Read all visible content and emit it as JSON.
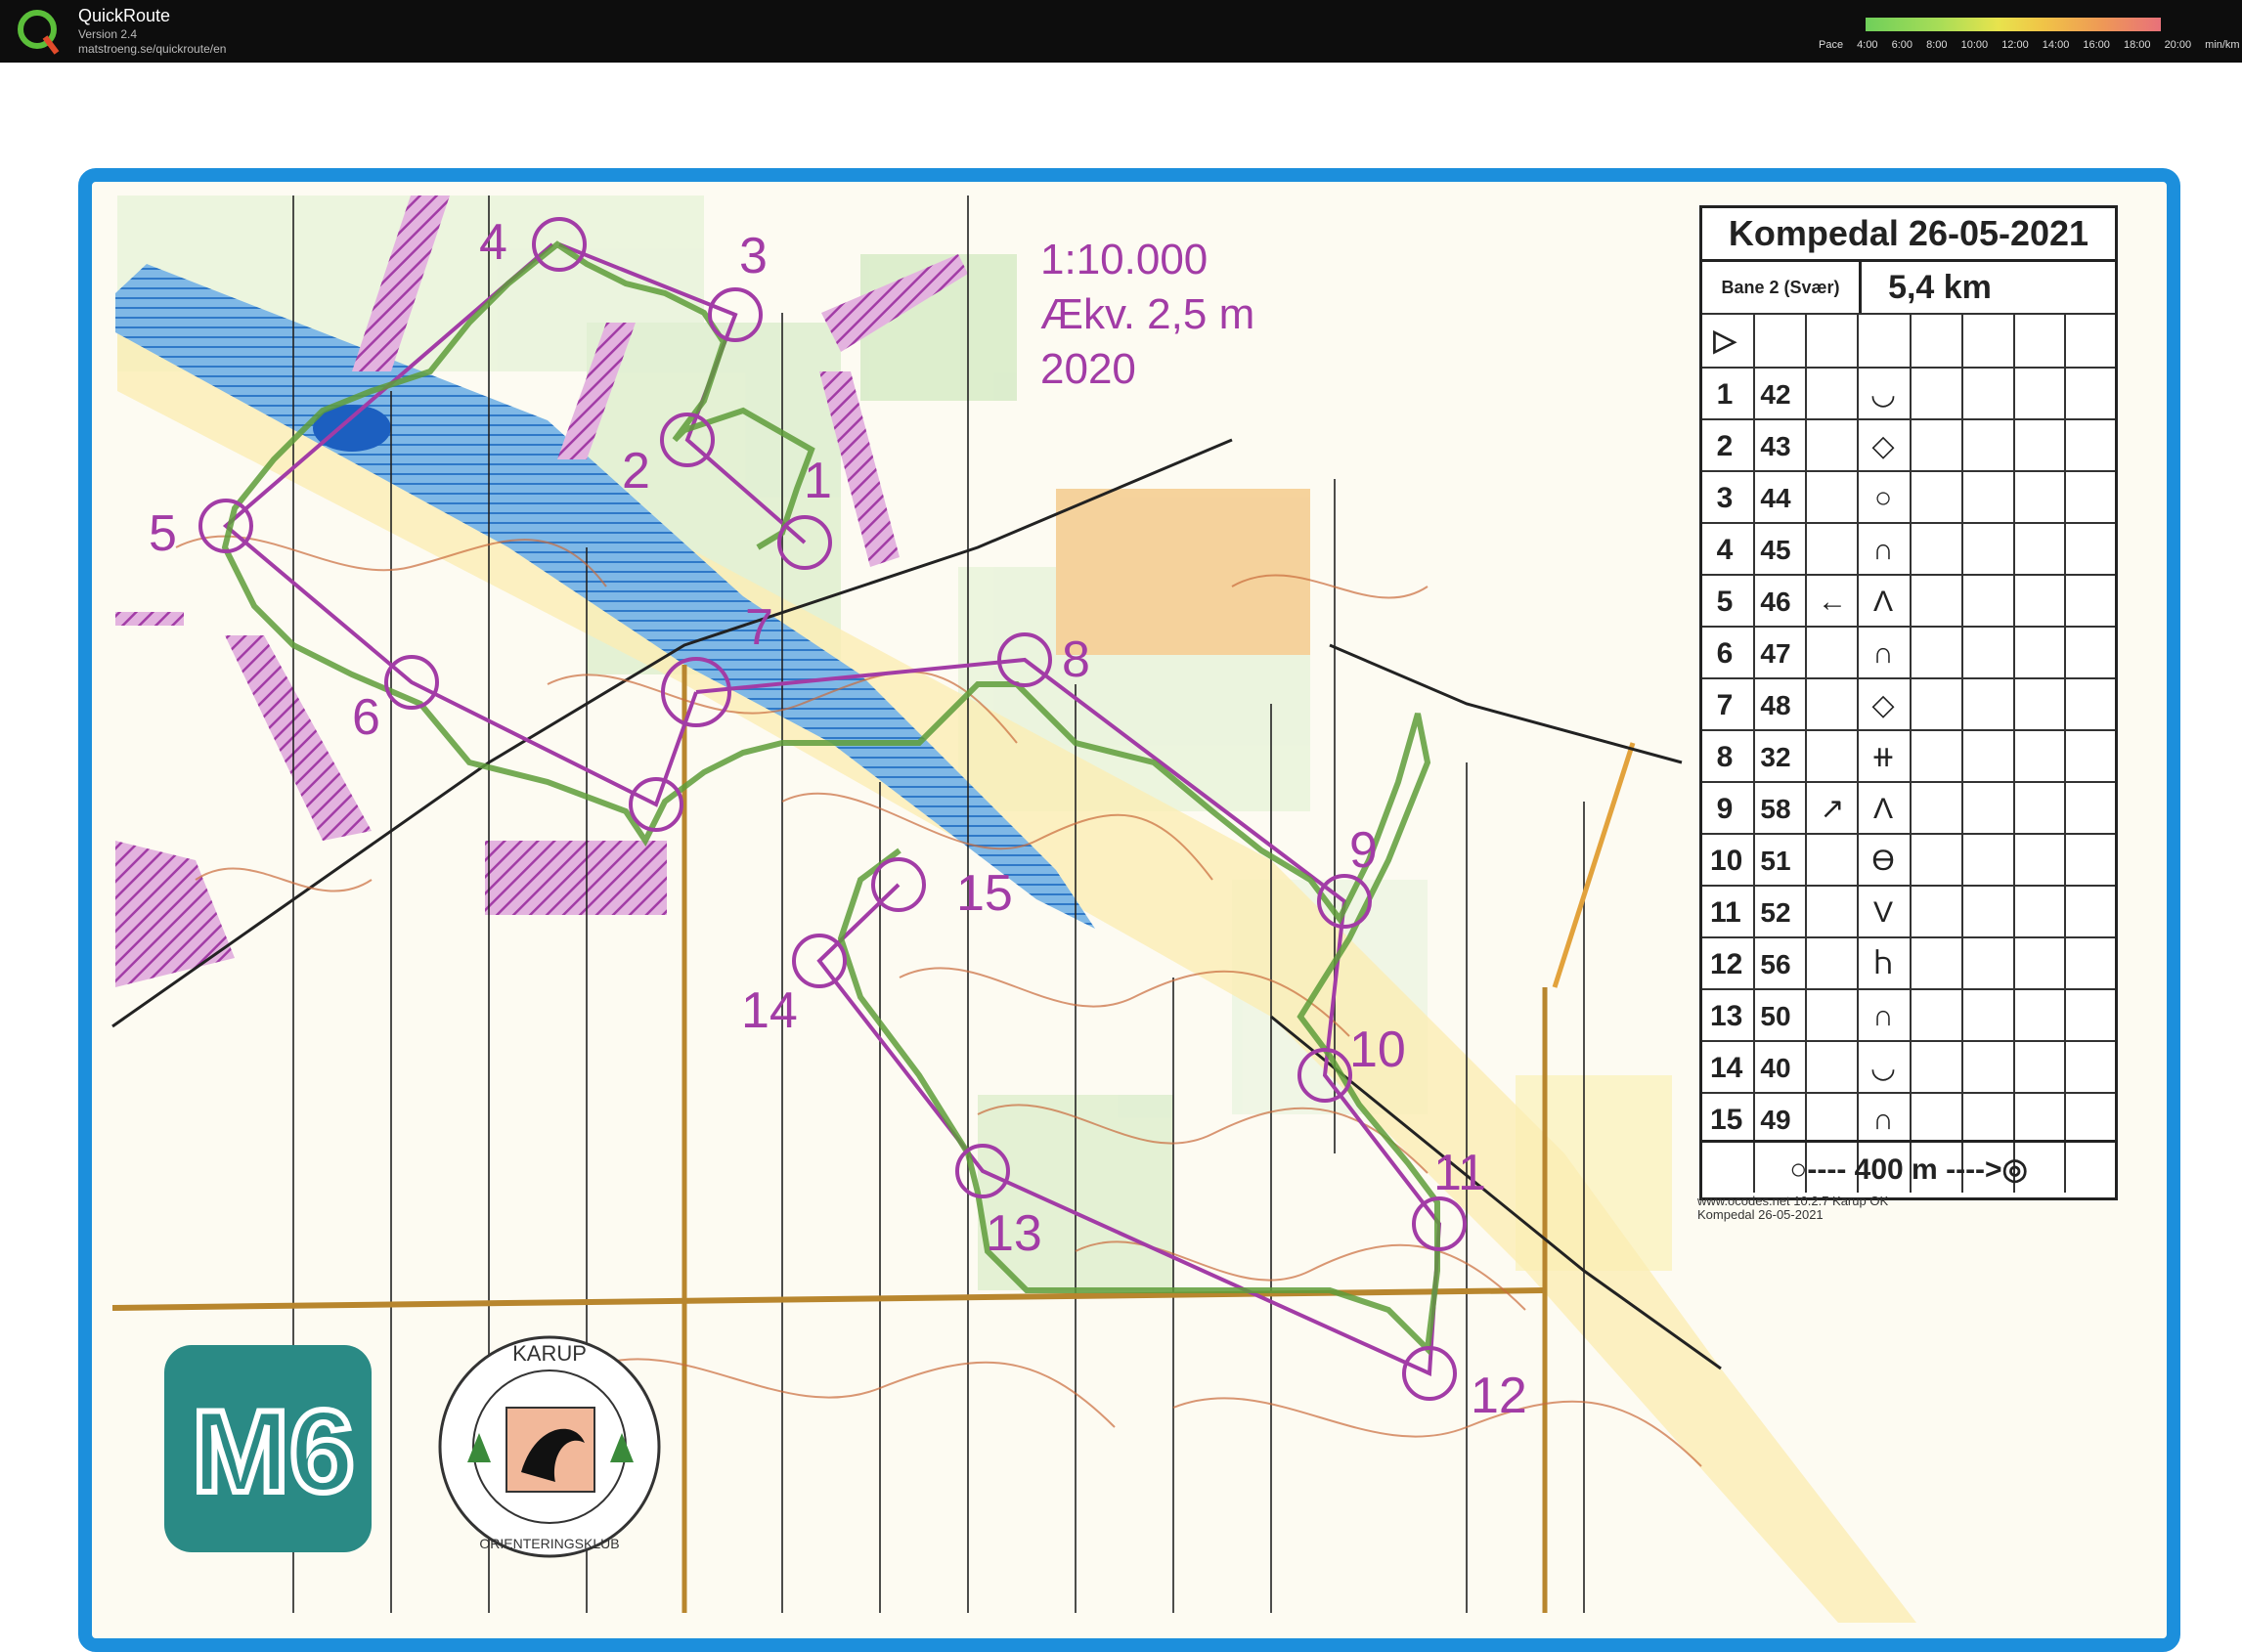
{
  "app": {
    "title": "QuickRoute",
    "version": "Version 2.4",
    "url": "matstroeng.se/quickroute/en",
    "pace_label": "Pace",
    "pace_ticks": [
      "4:00",
      "6:00",
      "8:00",
      "10:00",
      "12:00",
      "14:00",
      "16:00",
      "18:00",
      "20:00"
    ],
    "pace_unit": "min/km"
  },
  "map": {
    "scale": "1:10.000",
    "equidistance": "Ækv. 2,5 m",
    "year": "2020",
    "credit_line1": "www.ocodes.net 10.2.7 Karup OK",
    "credit_line2": "Kompedal 26-05-2021",
    "controls": [
      "1",
      "2",
      "3",
      "4",
      "5",
      "6",
      "7",
      "8",
      "9",
      "10",
      "11",
      "12",
      "13",
      "14",
      "15"
    ]
  },
  "control_card": {
    "title": "Kompedal 26-05-2021",
    "course": "Bane 2 (Svær)",
    "length": "5,4 km",
    "rows": [
      {
        "num": "1",
        "code": "42",
        "feature": "◡"
      },
      {
        "num": "2",
        "code": "43",
        "feature": "◇"
      },
      {
        "num": "3",
        "code": "44",
        "feature": "○"
      },
      {
        "num": "4",
        "code": "45",
        "feature": "∩"
      },
      {
        "num": "5",
        "code": "46",
        "feature": "Λ",
        "dir": "←"
      },
      {
        "num": "6",
        "code": "47",
        "feature": "∩"
      },
      {
        "num": "7",
        "code": "48",
        "feature": "◇"
      },
      {
        "num": "8",
        "code": "32",
        "feature": "⧺"
      },
      {
        "num": "9",
        "code": "58",
        "feature": "Λ",
        "dir": "↗"
      },
      {
        "num": "10",
        "code": "51",
        "feature": "ϴ"
      },
      {
        "num": "11",
        "code": "52",
        "feature": "V"
      },
      {
        "num": "12",
        "code": "56",
        "feature": "Ⴙ"
      },
      {
        "num": "13",
        "code": "50",
        "feature": "∩"
      },
      {
        "num": "14",
        "code": "40",
        "feature": "◡"
      },
      {
        "num": "15",
        "code": "49",
        "feature": "∩"
      }
    ],
    "scale_bar": "400 m"
  },
  "logos": {
    "m6": "M6",
    "club_top": "KARUP",
    "club_bottom": "ORIENTERINGSKLUB"
  },
  "colors": {
    "course": "#a23ca6",
    "route": "#5e9c3a",
    "frame": "#1c8fdc",
    "water": "#2f79c8",
    "contour": "#c96b3c"
  }
}
